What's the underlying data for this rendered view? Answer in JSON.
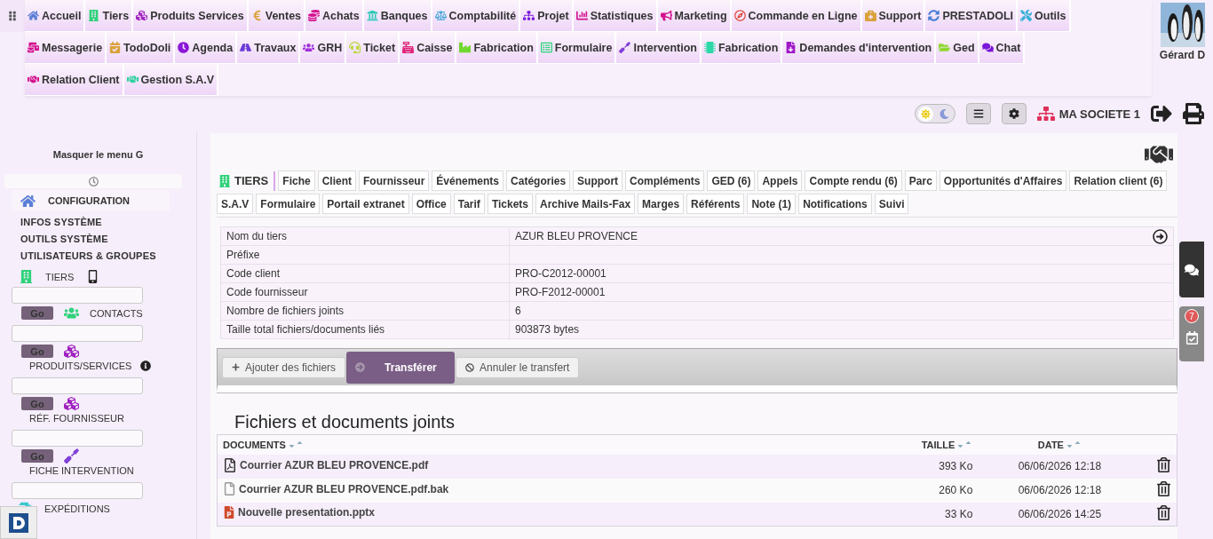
{
  "top_menu": [
    {
      "label": "Accueil"
    },
    {
      "label": "Tiers"
    },
    {
      "label": "Produits Services"
    },
    {
      "label": "Ventes"
    },
    {
      "label": "Achats"
    },
    {
      "label": "Banques"
    },
    {
      "label": "Comptabilité"
    },
    {
      "label": "Projet"
    },
    {
      "label": "Statistiques"
    },
    {
      "label": "Marketing"
    },
    {
      "label": "Commande en Ligne"
    },
    {
      "label": "Support"
    },
    {
      "label": "PRESTADOLI"
    },
    {
      "label": "Outils"
    },
    {
      "label": "Messagerie"
    },
    {
      "label": "TodoDoli"
    },
    {
      "label": "Agenda"
    },
    {
      "label": "Travaux"
    },
    {
      "label": "GRH"
    },
    {
      "label": "Ticket"
    },
    {
      "label": "Caisse"
    },
    {
      "label": "Fabrication"
    },
    {
      "label": "Formulaire"
    },
    {
      "label": "Intervention"
    },
    {
      "label": "Fabrication"
    },
    {
      "label": "Demandes d'intervention"
    },
    {
      "label": "Ged"
    },
    {
      "label": "Chat"
    },
    {
      "label": "Relation Client"
    },
    {
      "label": "Gestion S.A.V"
    }
  ],
  "user": {
    "name": "Gérard D"
  },
  "toolbar": {
    "dark_mode": false,
    "company": "MA SOCIETE 1"
  },
  "sidebar": {
    "hide_label": "Masquer le menu G",
    "section": "CONFIGURATION",
    "items": [
      "INFOS SYSTÈME",
      "OUTILS SYSTÈME",
      "UTILISATEURS & GROUPES"
    ],
    "tiers_label": "TIERS",
    "searches": [
      {
        "go": "Go",
        "label": "CONTACTS",
        "info": false
      },
      {
        "go": "Go",
        "label": "PRODUITS/SERVICES",
        "info": true
      },
      {
        "go": "Go",
        "label": "RÉF. FOURNISSEUR",
        "info": false
      },
      {
        "go": "Go",
        "label": "FICHE INTERVENTION",
        "info": false
      },
      {
        "label": "EXPÉDITIONS",
        "info": false
      }
    ]
  },
  "page": {
    "heading": "TIERS",
    "tabs": [
      {
        "label": "Fiche",
        "selected": false
      },
      {
        "label": "Client",
        "selected": false
      },
      {
        "label": "Fournisseur",
        "selected": false
      },
      {
        "label": "Événements",
        "selected": false
      },
      {
        "label": "Catégories",
        "selected": false
      },
      {
        "label": "Support",
        "selected": false
      },
      {
        "label": "Compléments",
        "selected": false
      },
      {
        "label": "GED (6)",
        "selected": false
      },
      {
        "label": "Appels",
        "selected": false
      },
      {
        "label": "Compte rendu (6)",
        "selected": false
      },
      {
        "label": "Parc",
        "selected": false
      },
      {
        "label": "Opportunités d'Affaires",
        "selected": false
      },
      {
        "label": "Relation client (6)",
        "selected": false
      },
      {
        "label": "S.A.V",
        "selected": false
      },
      {
        "label": "Formulaire",
        "selected": false
      },
      {
        "label": "Portail extranet",
        "selected": false
      },
      {
        "label": "Office",
        "selected": false
      },
      {
        "label": "Tarif",
        "selected": false
      },
      {
        "label": "Tickets",
        "selected": false
      },
      {
        "label": "Archive Mails-Fax",
        "selected": false
      },
      {
        "label": "Marges",
        "selected": false
      },
      {
        "label": "Référents",
        "selected": false
      },
      {
        "label": "Note (1)",
        "selected": false
      },
      {
        "label": "Notifications",
        "selected": false
      },
      {
        "label": "Suivi",
        "selected": false
      }
    ],
    "info": [
      {
        "label": "Nom du tiers",
        "value": "AZUR BLEU PROVENCE",
        "link": true
      },
      {
        "label": "Préfixe",
        "link": false
      },
      {
        "label": "Code client",
        "value": "PRO-C2012-00001",
        "link": false
      },
      {
        "label": "Code fournisseur",
        "value": "PRO-F2012-00001",
        "link": false
      },
      {
        "label": "Nombre de fichiers joints",
        "value": "6",
        "link": false
      },
      {
        "label": "Taille total fichiers/documents liés",
        "value": "903873 bytes",
        "link": false
      }
    ],
    "upload": {
      "add": "Ajouter des fichiers",
      "send": "Transférer",
      "cancel": "Annuler le transfert"
    },
    "files_title": "Fichiers et documents joints",
    "columns": [
      "DOCUMENTS",
      "TAILLE",
      "DATE"
    ],
    "files": [
      {
        "kind": "pdf",
        "name": "Courrier AZUR BLEU PROVENCE.pdf",
        "size": "393 Ko",
        "date": "06/06/2026 12:18"
      },
      {
        "kind": "file",
        "name": "Courrier AZUR BLEU PROVENCE.pdf.bak",
        "size": "260 Ko",
        "date": "06/06/2026 12:18"
      },
      {
        "kind": "slides",
        "name": "Nouvelle presentation.pptx",
        "size": "33 Ko",
        "date": "06/06/2026 14:25"
      }
    ]
  },
  "widgets": {
    "agenda_count": "7"
  }
}
